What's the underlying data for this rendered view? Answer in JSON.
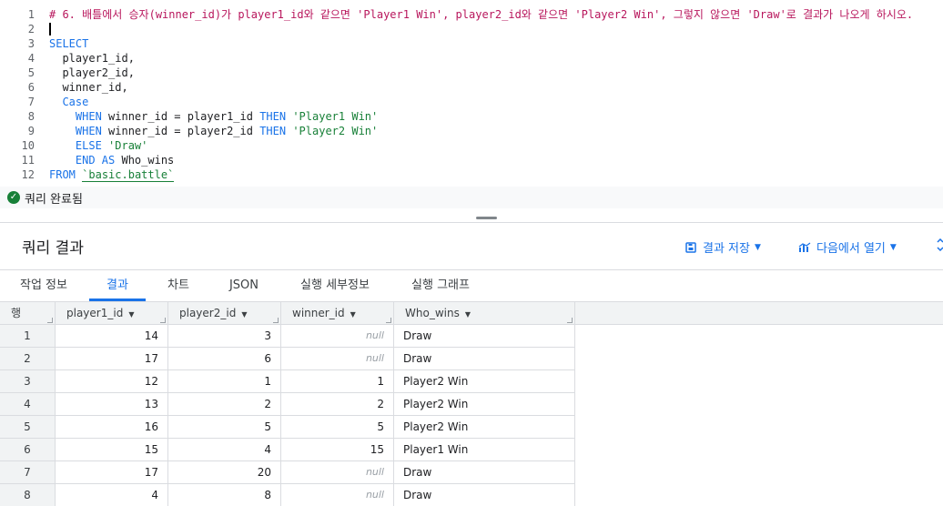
{
  "editor": {
    "lines": [
      {
        "n": "1",
        "tokens": [
          {
            "t": "# 6. 배틀에서 승자(winner_id)가 player1_id와 같으면 'Player1 Win', player2_id와 같으면 'Player2 Win', 그렇지 않으면 'Draw'로 결과가 나오게 하시오.",
            "c": "tok-comment"
          }
        ]
      },
      {
        "n": "2",
        "tokens": []
      },
      {
        "n": "3",
        "tokens": [
          {
            "t": "SELECT",
            "c": "tok-kw"
          }
        ]
      },
      {
        "n": "4",
        "tokens": [
          {
            "t": "  player1_id,",
            "c": "tok-plain"
          }
        ]
      },
      {
        "n": "5",
        "tokens": [
          {
            "t": "  player2_id,",
            "c": "tok-plain"
          }
        ]
      },
      {
        "n": "6",
        "tokens": [
          {
            "t": "  winner_id,",
            "c": "tok-plain"
          }
        ]
      },
      {
        "n": "7",
        "tokens": [
          {
            "t": "  Case",
            "c": "tok-kw"
          }
        ]
      },
      {
        "n": "8",
        "tokens": [
          {
            "t": "    WHEN",
            "c": "tok-kw"
          },
          {
            "t": " winner_id = player1_id ",
            "c": "tok-plain"
          },
          {
            "t": "THEN",
            "c": "tok-kw"
          },
          {
            "t": " 'Player1 Win'",
            "c": "tok-str"
          }
        ]
      },
      {
        "n": "9",
        "tokens": [
          {
            "t": "    WHEN",
            "c": "tok-kw"
          },
          {
            "t": " winner_id = player2_id ",
            "c": "tok-plain"
          },
          {
            "t": "THEN",
            "c": "tok-kw"
          },
          {
            "t": " 'Player2 Win'",
            "c": "tok-str"
          }
        ]
      },
      {
        "n": "10",
        "tokens": [
          {
            "t": "    ELSE",
            "c": "tok-kw"
          },
          {
            "t": " 'Draw'",
            "c": "tok-str"
          }
        ]
      },
      {
        "n": "11",
        "tokens": [
          {
            "t": "    END AS",
            "c": "tok-kw"
          },
          {
            "t": " Who_wins",
            "c": "tok-plain"
          }
        ]
      },
      {
        "n": "12",
        "tokens": [
          {
            "t": "FROM",
            "c": "tok-kw"
          },
          {
            "t": " ",
            "c": "tok-plain"
          },
          {
            "t": "`basic.battle`",
            "c": "tok-ul"
          }
        ]
      }
    ]
  },
  "status": {
    "text": "쿼리 완료됨"
  },
  "results": {
    "title": "쿼리 결과",
    "save_label": "결과 저장",
    "open_label": "다음에서 열기"
  },
  "tabs": [
    {
      "label": "작업 정보",
      "active": false
    },
    {
      "label": "결과",
      "active": true
    },
    {
      "label": "차트",
      "active": false
    },
    {
      "label": "JSON",
      "active": false
    },
    {
      "label": "실행 세부정보",
      "active": false
    },
    {
      "label": "실행 그래프",
      "active": false
    }
  ],
  "table": {
    "row_header": "행",
    "columns": [
      "player1_id",
      "player2_id",
      "winner_id",
      "Who_wins"
    ],
    "rows": [
      [
        "1",
        "14",
        "3",
        "null",
        "Draw"
      ],
      [
        "2",
        "17",
        "6",
        "null",
        "Draw"
      ],
      [
        "3",
        "12",
        "1",
        "1",
        "Player2 Win"
      ],
      [
        "4",
        "13",
        "2",
        "2",
        "Player2 Win"
      ],
      [
        "5",
        "16",
        "5",
        "5",
        "Player2 Win"
      ],
      [
        "6",
        "15",
        "4",
        "15",
        "Player1 Win"
      ],
      [
        "7",
        "17",
        "20",
        "null",
        "Draw"
      ],
      [
        "8",
        "4",
        "8",
        "null",
        "Draw"
      ]
    ]
  },
  "colors": {
    "accent": "#1a73e8",
    "success": "#188038"
  }
}
